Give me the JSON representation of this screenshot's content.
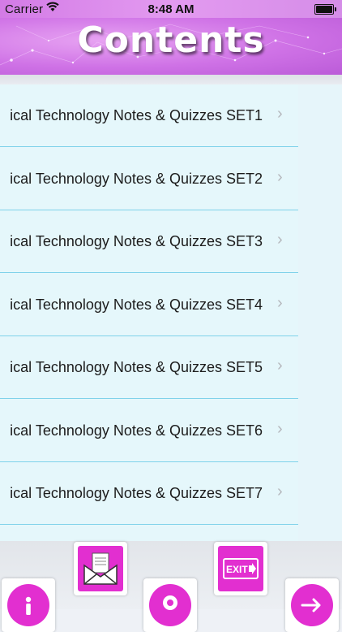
{
  "status_bar": {
    "carrier": "Carrier",
    "time": "8:48 AM"
  },
  "header": {
    "title": "Contents"
  },
  "list": {
    "items": [
      {
        "label": "ical Technology Notes & Quizzes SET1"
      },
      {
        "label": "ical Technology Notes & Quizzes SET2"
      },
      {
        "label": "ical Technology Notes & Quizzes SET3"
      },
      {
        "label": "ical Technology Notes & Quizzes SET4"
      },
      {
        "label": "ical Technology Notes & Quizzes SET5"
      },
      {
        "label": "ical Technology Notes & Quizzes SET6"
      },
      {
        "label": "ical Technology Notes & Quizzes SET7"
      }
    ]
  },
  "bottom_bar": {
    "buttons": [
      "info-icon",
      "mail-icon",
      "location-icon",
      "exit-icon",
      "arrow-right-icon"
    ],
    "exit_label": "EXIT"
  },
  "colors": {
    "header": "#cf72e6",
    "accent": "#e22fd0",
    "list_bg": "#e5f7fb",
    "separator": "#7fd2ea"
  }
}
